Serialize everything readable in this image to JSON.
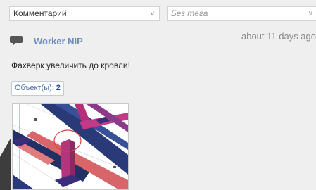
{
  "filters": {
    "type_select": {
      "value": "Комментарий",
      "icon": "chevron-down-icon"
    },
    "tag_select": {
      "value": "Без тега",
      "icon": "chevron-down-icon"
    }
  },
  "comment": {
    "icon": "comment-icon",
    "author": "Worker NIP",
    "time": "about 11 days ago",
    "text": "Фахверк увеличить до кровли!",
    "objects_label": "Объект(ы):",
    "objects_count": "2"
  },
  "colors": {
    "author_link": "#6b8cbe",
    "beam_blue": "#2a3a78",
    "beam_magenta": "#b52f7a",
    "beam_red": "#d8656a",
    "beam_green": "#3fb88a",
    "markup_circle": "#d64545"
  }
}
